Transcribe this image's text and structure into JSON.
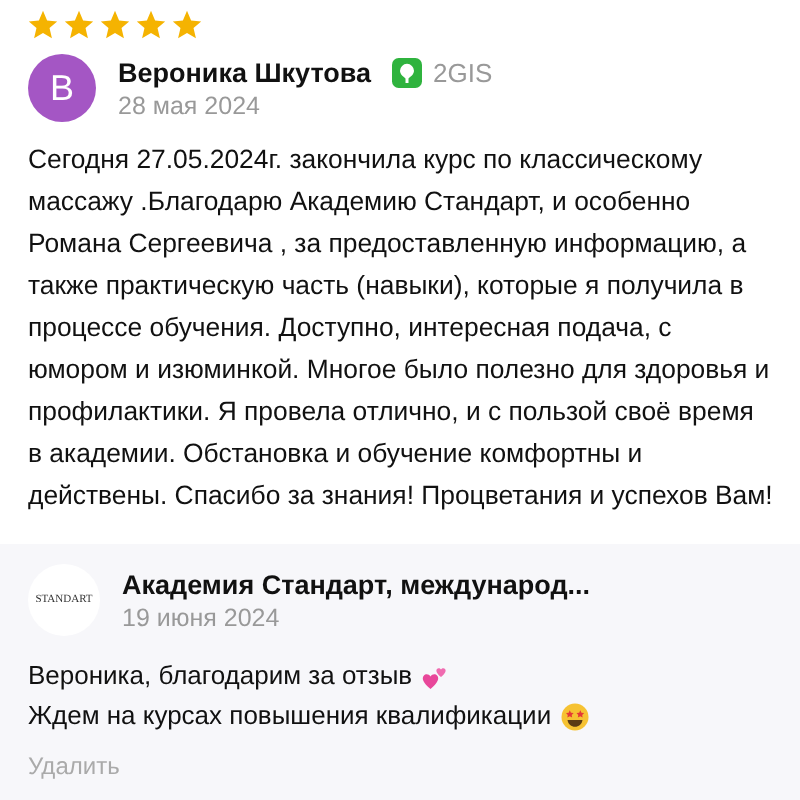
{
  "review": {
    "stars": 5,
    "avatar_letter": "В",
    "author": "Вероника Шкутова",
    "source": "2GIS",
    "date": "28 мая 2024",
    "text": "Сегодня 27.05.2024г. закончила курс по классическому массажу .Благодарю Академию Стандарт, и особенно Романа Сергеевича , за предоставленную информацию, а также практическую часть (навыки), которые я получила в процессе обучения. Доступно, интересная подача, с юмором и изюминкой. Многое было полезно для здоровья и профилактики. Я провела отлично, и с пользой своё время в академии. Обстановка и обучение комфортны и действены. Спасибо за знания! Процветания и успехов Вам!"
  },
  "reply": {
    "logo_text": "STANDART",
    "author": "Академия Стандарт, международ...",
    "date": "19 июня 2024",
    "lines": [
      {
        "text": "Вероника, благодарим за отзыв",
        "kind": "hearts"
      },
      {
        "text": "Ждем на курсах повышения квалификации",
        "kind": "star-eyes"
      }
    ],
    "delete_link": "Удалить"
  }
}
